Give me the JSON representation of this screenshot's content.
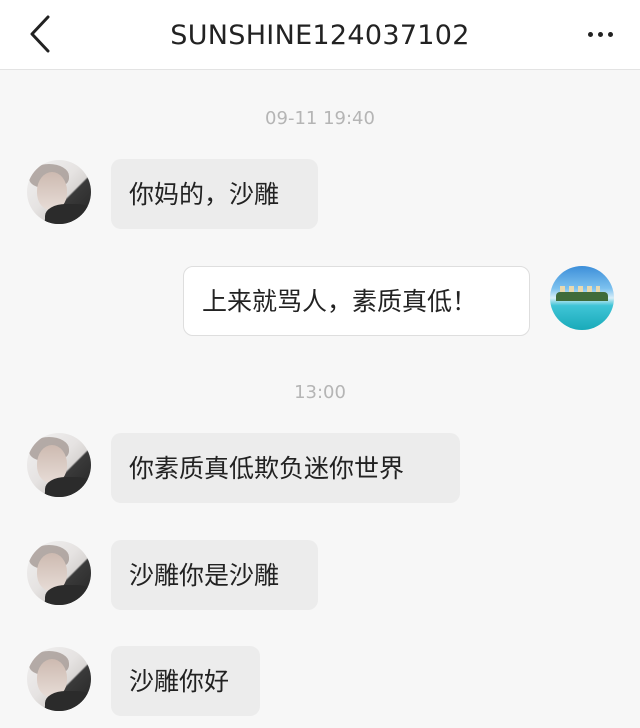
{
  "header": {
    "title": "SUNSHINE124037102",
    "back_icon": "chevron-left-icon",
    "more_icon": "more-horizontal-icon"
  },
  "chat": {
    "timestamps": [
      "09-11 19:40",
      "13:00"
    ],
    "messages": [
      {
        "side": "left",
        "text": "你妈的，沙雕"
      },
      {
        "side": "right",
        "text": "上来就骂人，素质真低！"
      },
      {
        "side": "left",
        "text": "你素质真低欺负迷你世界"
      },
      {
        "side": "left",
        "text": "沙雕你是沙雕"
      },
      {
        "side": "left",
        "text": "沙雕你好"
      }
    ]
  },
  "colors": {
    "header_bg": "#ffffff",
    "chat_bg": "#f7f7f7",
    "left_bubble": "#ececec",
    "right_bubble": "#ffffff",
    "timestamp_text": "#b5b5b5",
    "message_text": "#222222"
  }
}
